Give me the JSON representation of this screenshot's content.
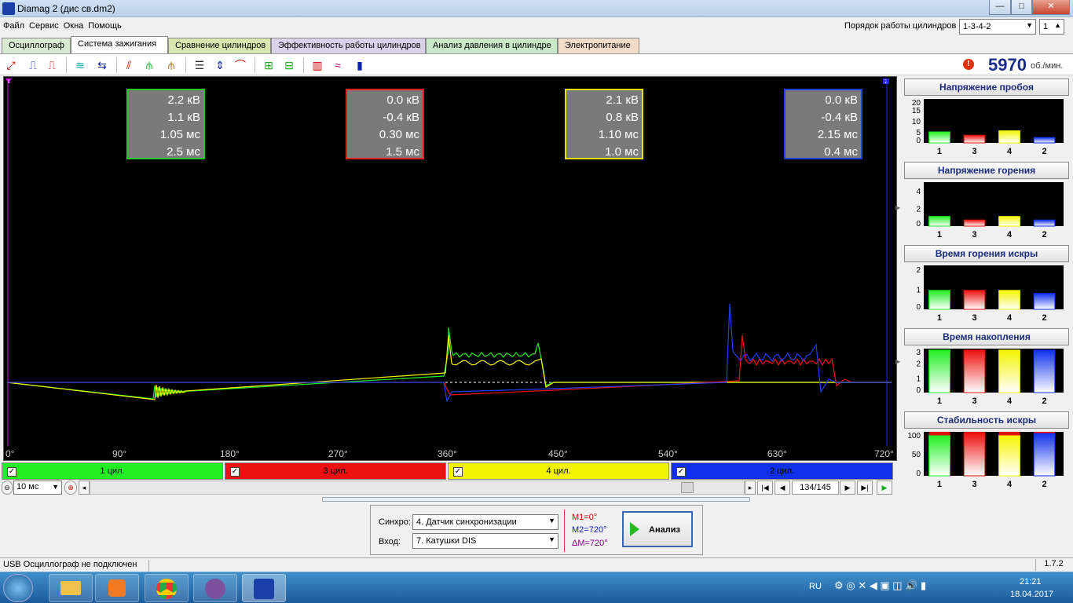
{
  "window": {
    "title": "Diamag 2 (дис св.dm2)",
    "minimize": "—",
    "maximize": "□",
    "close": "✕"
  },
  "menu": [
    "Файл",
    "Сервис",
    "Окна",
    "Помощь"
  ],
  "firing_order": {
    "label": "Порядок работы цилиндров",
    "value": "1-3-4-2",
    "number": "1"
  },
  "tabs": [
    "Осциллограф",
    "Система зажигания",
    "Сравнение цилиндров",
    "Эффективность работы цилиндров",
    "Анализ давления в цилиндре",
    "Электропитание"
  ],
  "tab_colors": [
    "#d9ead3",
    "#ffffff",
    "#d6e8b0",
    "#d9d2e9",
    "#c9e7c9",
    "#f2dcc8"
  ],
  "rpm": {
    "value": "5970",
    "unit": "об./мин."
  },
  "scope": {
    "info_boxes": [
      {
        "lines": [
          "2.2 кВ",
          "1.1 кВ",
          "1.05 мс",
          "2.5 мс"
        ],
        "color": "#22cc22"
      },
      {
        "lines": [
          "0.0 кВ",
          "-0.4 кВ",
          "0.30 мс",
          "1.5 мс"
        ],
        "color": "#e02020"
      },
      {
        "lines": [
          "2.1 кВ",
          "0.8 кВ",
          "1.10 мс",
          "1.0 мс"
        ],
        "color": "#e8e000"
      },
      {
        "lines": [
          "0.0 кВ",
          "-0.4 кВ",
          "2.15 мс",
          "0.4 мс"
        ],
        "color": "#2040e0"
      }
    ],
    "x_ticks": [
      "0°",
      "90°",
      "180°",
      "270°",
      "360°",
      "450°",
      "540°",
      "630°",
      "720°"
    ],
    "marker1": "1",
    "marker2": "2"
  },
  "cylinders": [
    {
      "label": "1 цил.",
      "color": "#22ee22"
    },
    {
      "label": "3 цил.",
      "color": "#ee1111"
    },
    {
      "label": "4 цил.",
      "color": "#f4f400"
    },
    {
      "label": "2 цил.",
      "color": "#1030ee"
    }
  ],
  "nav": {
    "time_base": "10 мс",
    "counter": "134/145"
  },
  "panels": [
    {
      "title": "Напряжение пробоя",
      "yticks": [
        "20",
        "15",
        "10",
        "5",
        "0"
      ],
      "ymax": 20,
      "values": [
        5,
        3.5,
        5.5,
        2.5
      ]
    },
    {
      "title": "Напряжение горения",
      "yticks": [
        "4",
        "2",
        "0"
      ],
      "ymax": 5,
      "values": [
        1.1,
        0.7,
        1.1,
        0.7
      ]
    },
    {
      "title": "Время горения искры",
      "yticks": [
        "2",
        "1",
        "0"
      ],
      "ymax": 2.2,
      "values": [
        0.95,
        0.95,
        0.95,
        0.8
      ]
    },
    {
      "title": "Время накопления",
      "yticks": [
        "3",
        "2",
        "1",
        "0"
      ],
      "ymax": 3,
      "values": [
        2.9,
        2.9,
        2.9,
        2.9
      ]
    },
    {
      "title": "Стабильность искры",
      "yticks": [
        "100",
        "50",
        "0"
      ],
      "ymax": 100,
      "values": [
        92,
        97,
        92,
        97
      ]
    }
  ],
  "panel_xlabels": [
    "1",
    "3",
    "4",
    "2"
  ],
  "bottom": {
    "sync_label": "Синхро:",
    "sync_value": "4.  Датчик синхронизации",
    "input_label": "Вход:",
    "input_value": "7.  Катушки DIS",
    "m1": "M1=0°",
    "m2": "M2=720°",
    "dm": "ΔM=720°",
    "analysis_button": "Анализ"
  },
  "status": {
    "text": "USB Осциллограф не подключен",
    "version": "1.7.2"
  },
  "tray": {
    "lang": "RU",
    "time": "21:21",
    "date": "18.04.2017"
  }
}
